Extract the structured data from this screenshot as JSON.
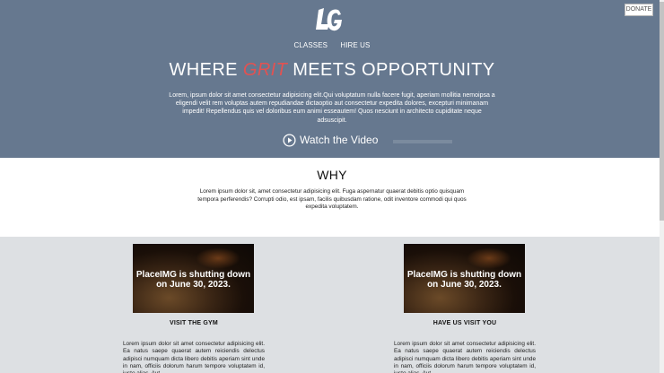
{
  "header": {
    "logo_text": "LG",
    "donate_label": "DONATE",
    "nav": [
      "CLASSES",
      "HIRE US"
    ],
    "headline_pre": "WHERE ",
    "headline_accent": "GRIT",
    "headline_post": " MEETS OPPORTUNITY",
    "intro": "Lorem, ipsum dolor sit amet consectetur adipisicing elit.Qui voluptatum nulla facere fugit, aperiam mollitia nemoipsa a eligendi velit rem voluptas autem repudiandae dictaoptio aut consectetur expedita dolores, excepturi minimanam impedit! Repellendus quis vel doloribus eum animi esseautem! Quos nesciunt in architecto cupiditate neque adsuscipit.",
    "watch_label": "Watch the Video",
    "play_icon": "play-circle-icon",
    "accent_color": "#e25252",
    "hero_color": "#66788f"
  },
  "why": {
    "title": "WHY",
    "text": "Lorem ipsum dolor sit, amet consectetur adipisicing elit. Fuga aspernatur quaerat debitis optio quisquam tempora perferendis? Corrupti odio, est ipsam, facilis quibusdam ratione, odit inventore commodi qui quos expedita voluptatem."
  },
  "cards": [
    {
      "image_text": "PlaceIMG is shutting down on June 30, 2023.",
      "title": "VISIT THE GYM",
      "text": "Lorem ipsum dolor sit amet consectetur adipisicing elit. Ea natus saepe quaerat autem reiciendis delectus adipisci numquam dicta libero debitis aperiam sint unde in nam, officiis dolorum harum tempore voluptatem id, iusto alias. Aut"
    },
    {
      "image_text": "PlaceIMG is shutting down on June 30, 2023.",
      "title": "HAVE US VISIT YOU",
      "text": "Lorem ipsum dolor sit amet consectetur adipisicing elit. Ea natus saepe quaerat autem reiciendis delectus adipisci numquam dicta libero debitis aperiam sint unde in nam, officiis dolorum harum tempore voluptatem id, iusto alias. Aut"
    }
  ]
}
